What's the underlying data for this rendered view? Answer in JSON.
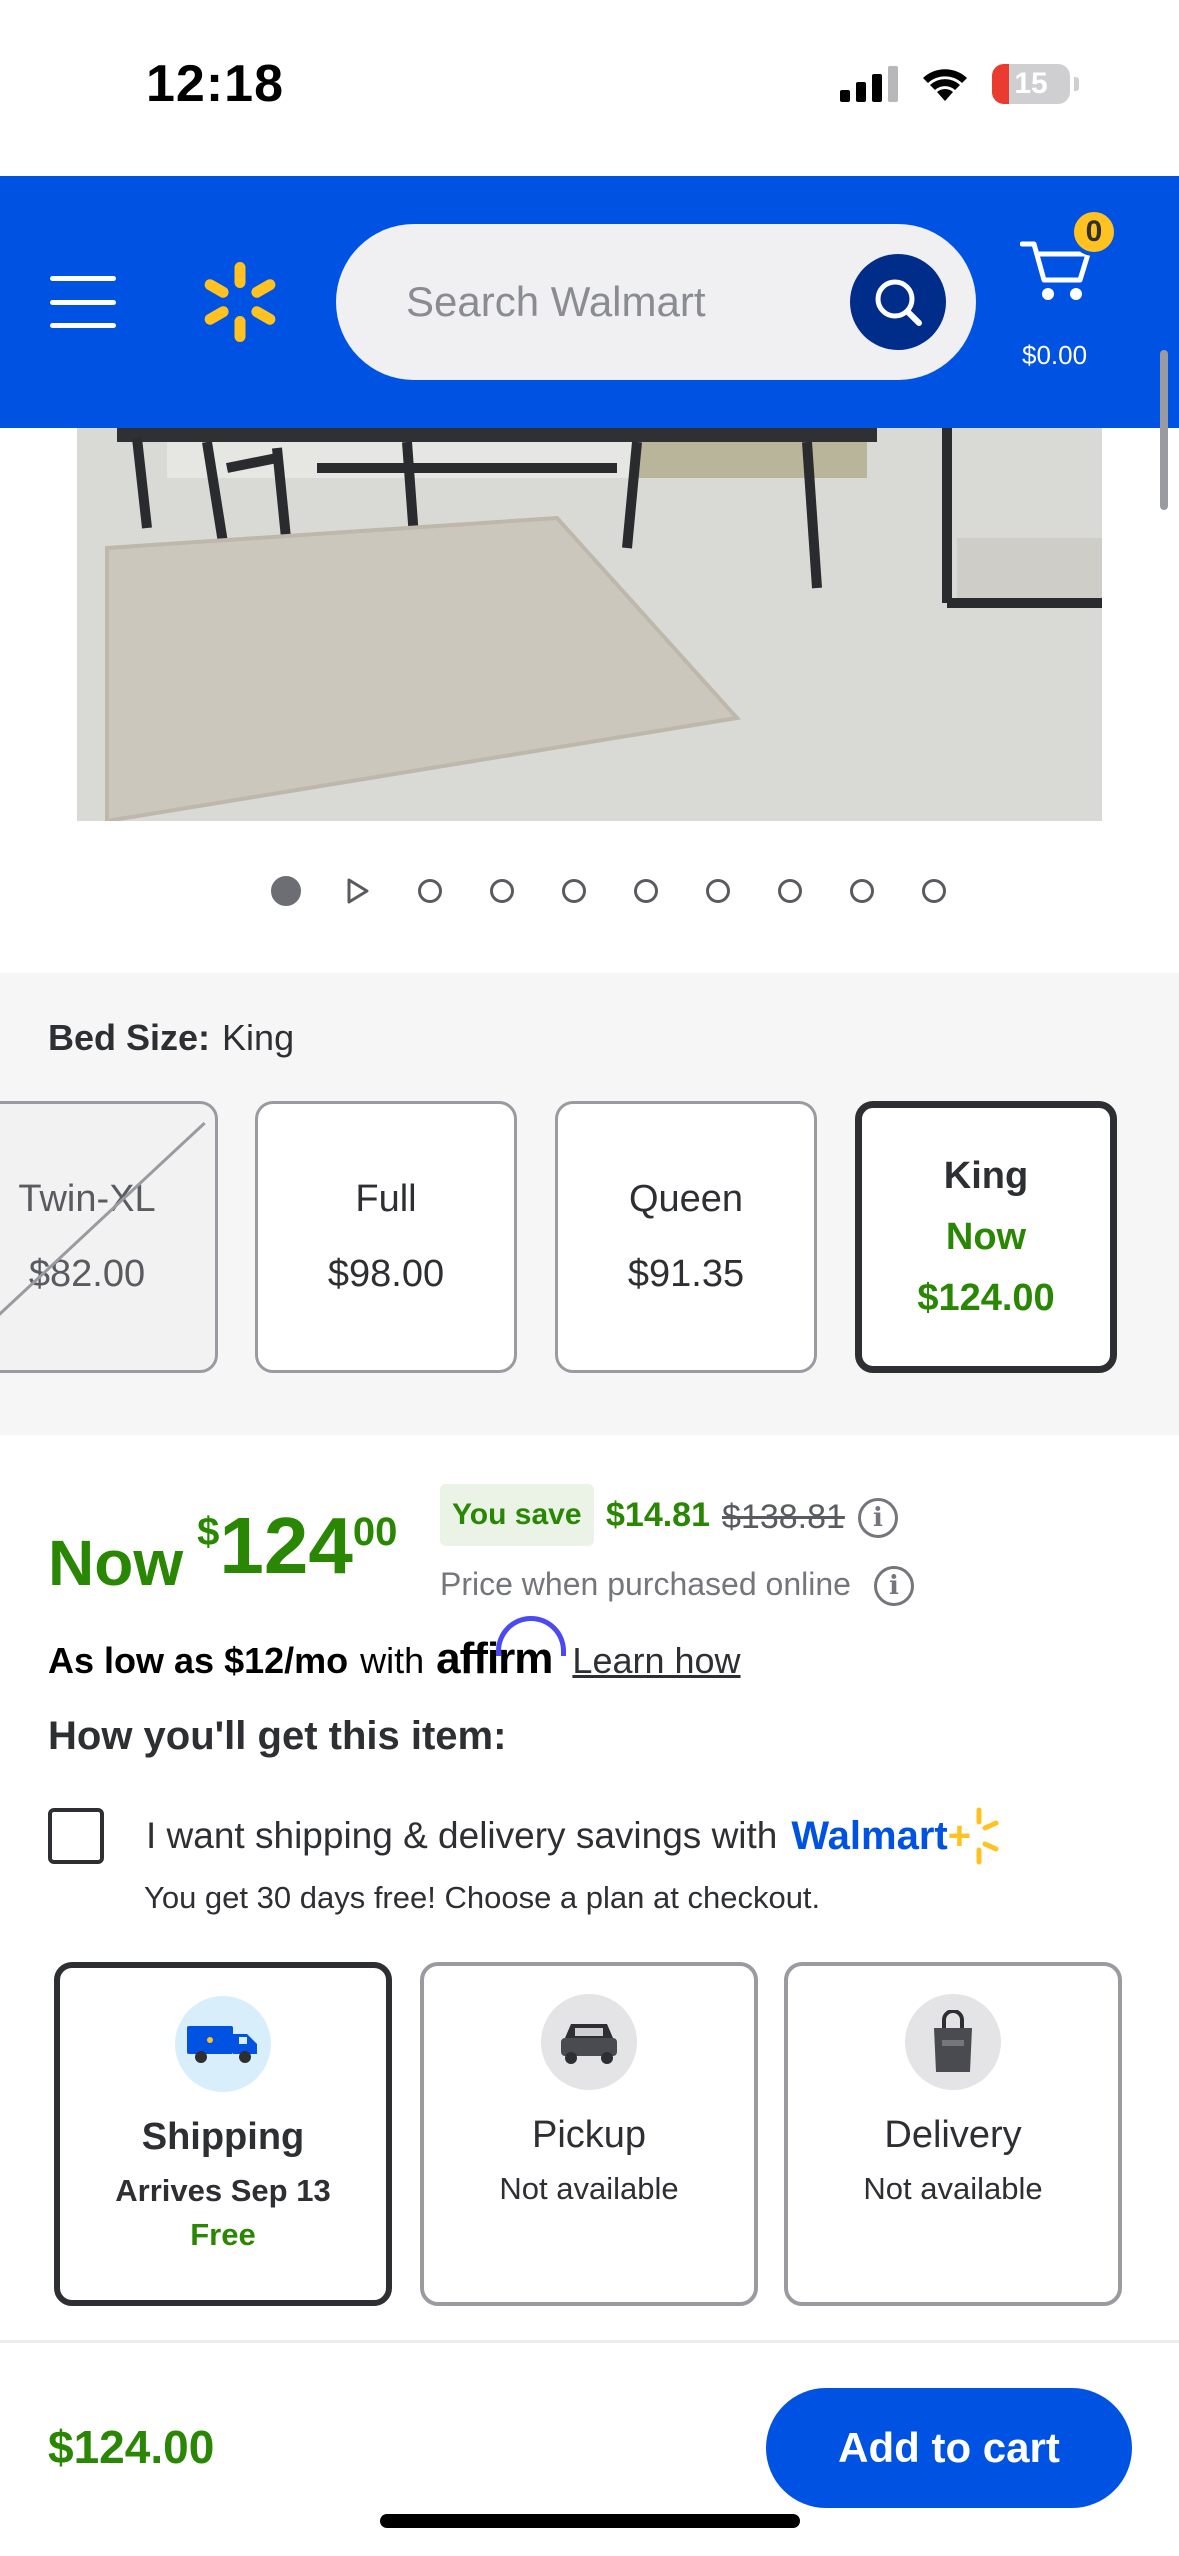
{
  "status_bar": {
    "time": "12:18",
    "battery": "15"
  },
  "header": {
    "search_placeholder": "Search Walmart",
    "cart_count": "0",
    "cart_total": "$0.00",
    "brand_color": "#0053e2",
    "spark_color": "#ffc220"
  },
  "carousel": {
    "dot_count": 10,
    "active_index": 0,
    "video_index": 1
  },
  "variants": {
    "label": "Bed Size:",
    "selected_value": "King",
    "options": [
      {
        "name": "Twin-XL",
        "price": "$82.00",
        "status": "unavailable"
      },
      {
        "name": "Full",
        "price": "$98.00",
        "status": "available"
      },
      {
        "name": "Queen",
        "price": "$91.35",
        "status": "available"
      },
      {
        "name": "King",
        "price_prefix": "Now",
        "price": "$124.00",
        "status": "selected"
      }
    ]
  },
  "price": {
    "now_label": "Now",
    "currency": "$",
    "whole": "124",
    "cents": "00",
    "you_save_label": "You save",
    "save_amount": "$14.81",
    "was_price": "$138.81",
    "online_note": "Price when purchased online",
    "accent_color": "#2a8703"
  },
  "affirm": {
    "as_low_as": "As low as $12/mo",
    "with": "with",
    "logo": "affirm",
    "learn_how": "Learn how"
  },
  "fulfillment": {
    "heading": "How you'll get this item:",
    "walmart_plus_text": "I want shipping & delivery savings with",
    "walmart_plus_logo": "Walmart",
    "walmart_plus_logo_plus": "+",
    "free_note": "You get 30 days free! Choose a plan at checkout.",
    "options": [
      {
        "title": "Shipping",
        "sub": "Arrives Sep 13",
        "extra": "Free",
        "icon": "truck-icon",
        "selected": true
      },
      {
        "title": "Pickup",
        "sub": "Not available",
        "icon": "car-icon",
        "selected": false
      },
      {
        "title": "Delivery",
        "sub": "Not available",
        "icon": "bag-icon",
        "selected": false
      }
    ]
  },
  "bottom_bar": {
    "price": "$124.00",
    "add_to_cart": "Add to cart"
  }
}
